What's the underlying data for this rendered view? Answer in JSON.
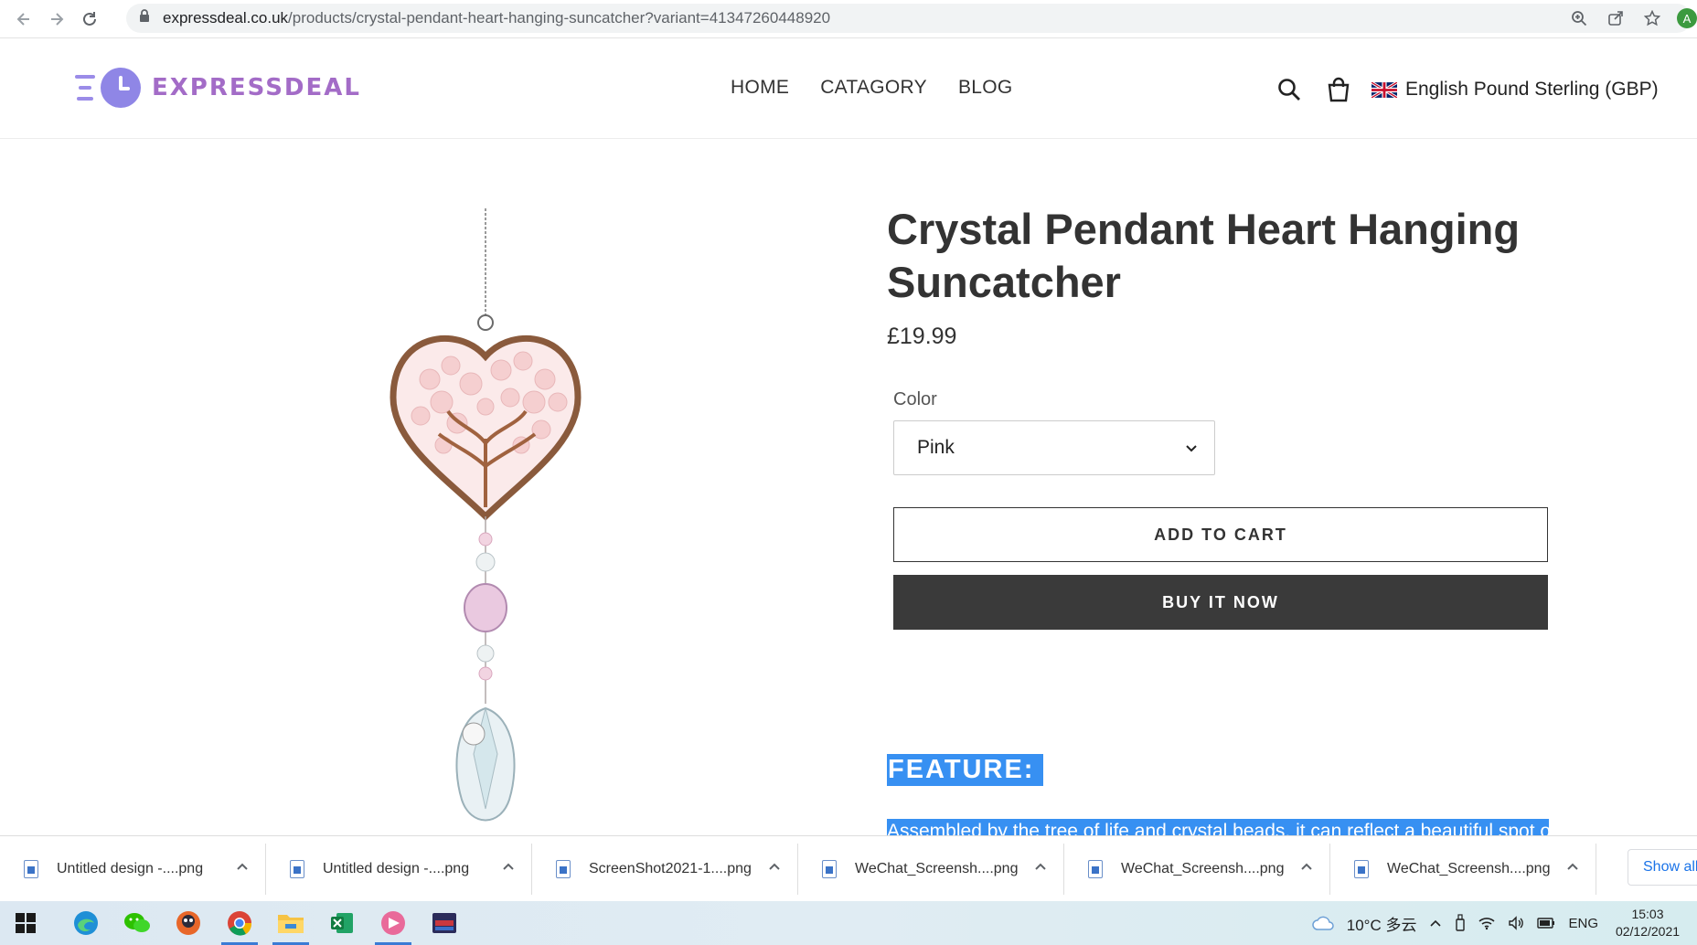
{
  "browser": {
    "url_host": "expressdeal.co.uk",
    "url_path": "/products/crystal-pendant-heart-hanging-suncatcher?variant=41347260448920",
    "profile_initial": "A"
  },
  "header": {
    "logo_text": "EXPRESSDEAL",
    "nav": [
      "HOME",
      "CATAGORY",
      "BLOG"
    ],
    "currency": "English Pound Sterling (GBP)"
  },
  "product": {
    "title": "Crystal Pendant Heart Hanging Suncatcher",
    "price": "£19.99",
    "option_label": "Color",
    "option_value": "Pink",
    "add_to_cart": "ADD TO CART",
    "buy_now": "BUY IT NOW",
    "feature_heading": "FEATURE:",
    "feature_text": "Assembled by the tree of life and crystal beads, it can reflect a beautiful spot of"
  },
  "downloads": {
    "items": [
      "Untitled design -....png",
      "Untitled design -....png",
      "ScreenShot2021-1....png",
      "WeChat_Screensh....png",
      "WeChat_Screensh....png",
      "WeChat_Screensh....png"
    ],
    "show_all": "Show all"
  },
  "taskbar": {
    "weather": "10°C 多云",
    "language": "ENG",
    "time": "15:03",
    "date": "02/12/2021"
  },
  "colors": {
    "logo_purple": "#a36cc7",
    "logo_clock": "#8f86e6",
    "buy_button": "#3a3a3a",
    "selection_blue": "#3790f2"
  }
}
